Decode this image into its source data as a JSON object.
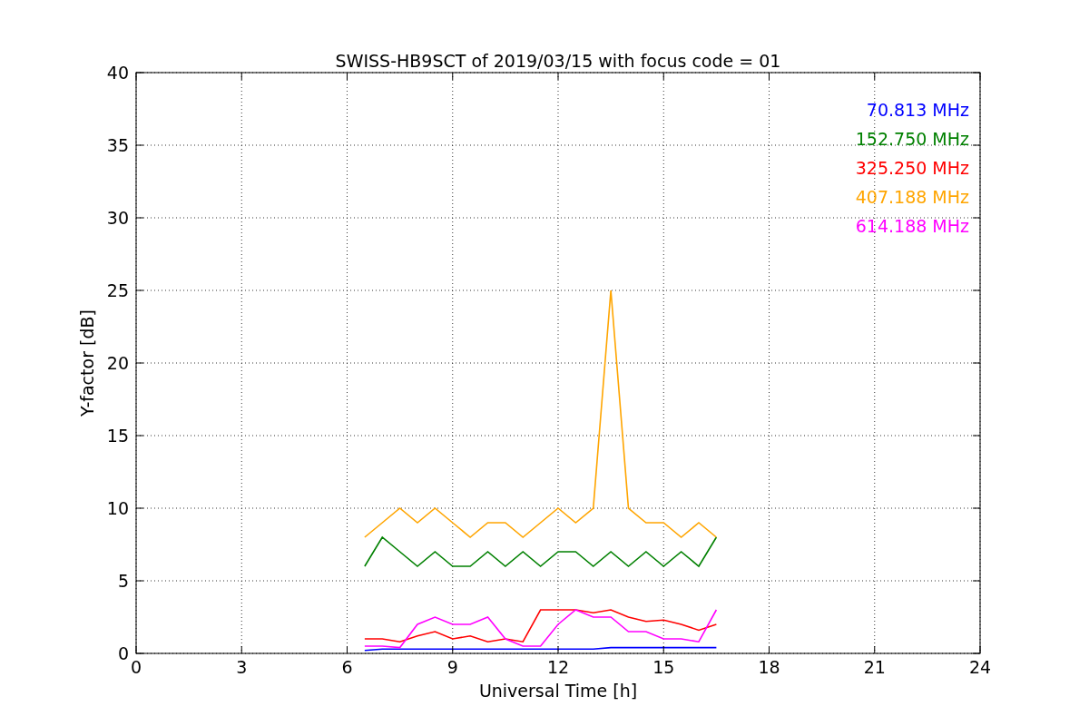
{
  "figure": {
    "chart_data": {
      "type": "line",
      "title": "SWISS-HB9SCT of 2019/03/15 with focus code = 01",
      "xlabel": "Universal Time [h]",
      "ylabel": "Y-factor [dB]",
      "x": [
        6.5,
        7,
        7.5,
        8,
        8.5,
        9,
        9.5,
        10,
        10.5,
        11,
        11.5,
        12,
        12.5,
        13,
        13.5,
        14,
        14.5,
        15,
        15.5,
        16,
        16.5
      ],
      "xlim": [
        0,
        24
      ],
      "ylim": [
        0,
        40
      ],
      "xticks": [
        0,
        3,
        6,
        9,
        12,
        15,
        18,
        21,
        24
      ],
      "yticks": [
        0,
        5,
        10,
        15,
        20,
        25,
        30,
        35,
        40
      ],
      "grid": true,
      "series": [
        {
          "name": "70.813 MHz",
          "color": "#0000ff",
          "values": [
            0.2,
            0.3,
            0.3,
            0.3,
            0.3,
            0.3,
            0.3,
            0.3,
            0.3,
            0.3,
            0.3,
            0.3,
            0.3,
            0.3,
            0.4,
            0.4,
            0.4,
            0.4,
            0.4,
            0.4,
            0.4
          ]
        },
        {
          "name": "152.750 MHz",
          "color": "#008000",
          "values": [
            6,
            8,
            7,
            6,
            7,
            6,
            6,
            7,
            6,
            7,
            6,
            7,
            7,
            6,
            7,
            6,
            7,
            6,
            7,
            6,
            8
          ]
        },
        {
          "name": "325.250 MHz",
          "color": "#ff0000",
          "values": [
            1,
            1,
            0.8,
            1.2,
            1.5,
            1,
            1.2,
            0.8,
            1,
            0.8,
            3,
            3,
            3,
            2.8,
            3,
            2.5,
            2.2,
            2.3,
            2,
            1.6,
            2
          ]
        },
        {
          "name": "407.188 MHz",
          "color": "#ffa500",
          "values": [
            8,
            9,
            10,
            9,
            10,
            9,
            8,
            9,
            9,
            8,
            9,
            10,
            9,
            10,
            25,
            10,
            9,
            9,
            8,
            9,
            8
          ]
        },
        {
          "name": "614.188 MHz",
          "color": "#ff00ff",
          "values": [
            0.5,
            0.5,
            0.4,
            2,
            2.5,
            2,
            2,
            2.5,
            1,
            0.5,
            0.5,
            2,
            3,
            2.5,
            2.5,
            1.5,
            1.5,
            1,
            1,
            0.8,
            3
          ]
        }
      ]
    }
  }
}
